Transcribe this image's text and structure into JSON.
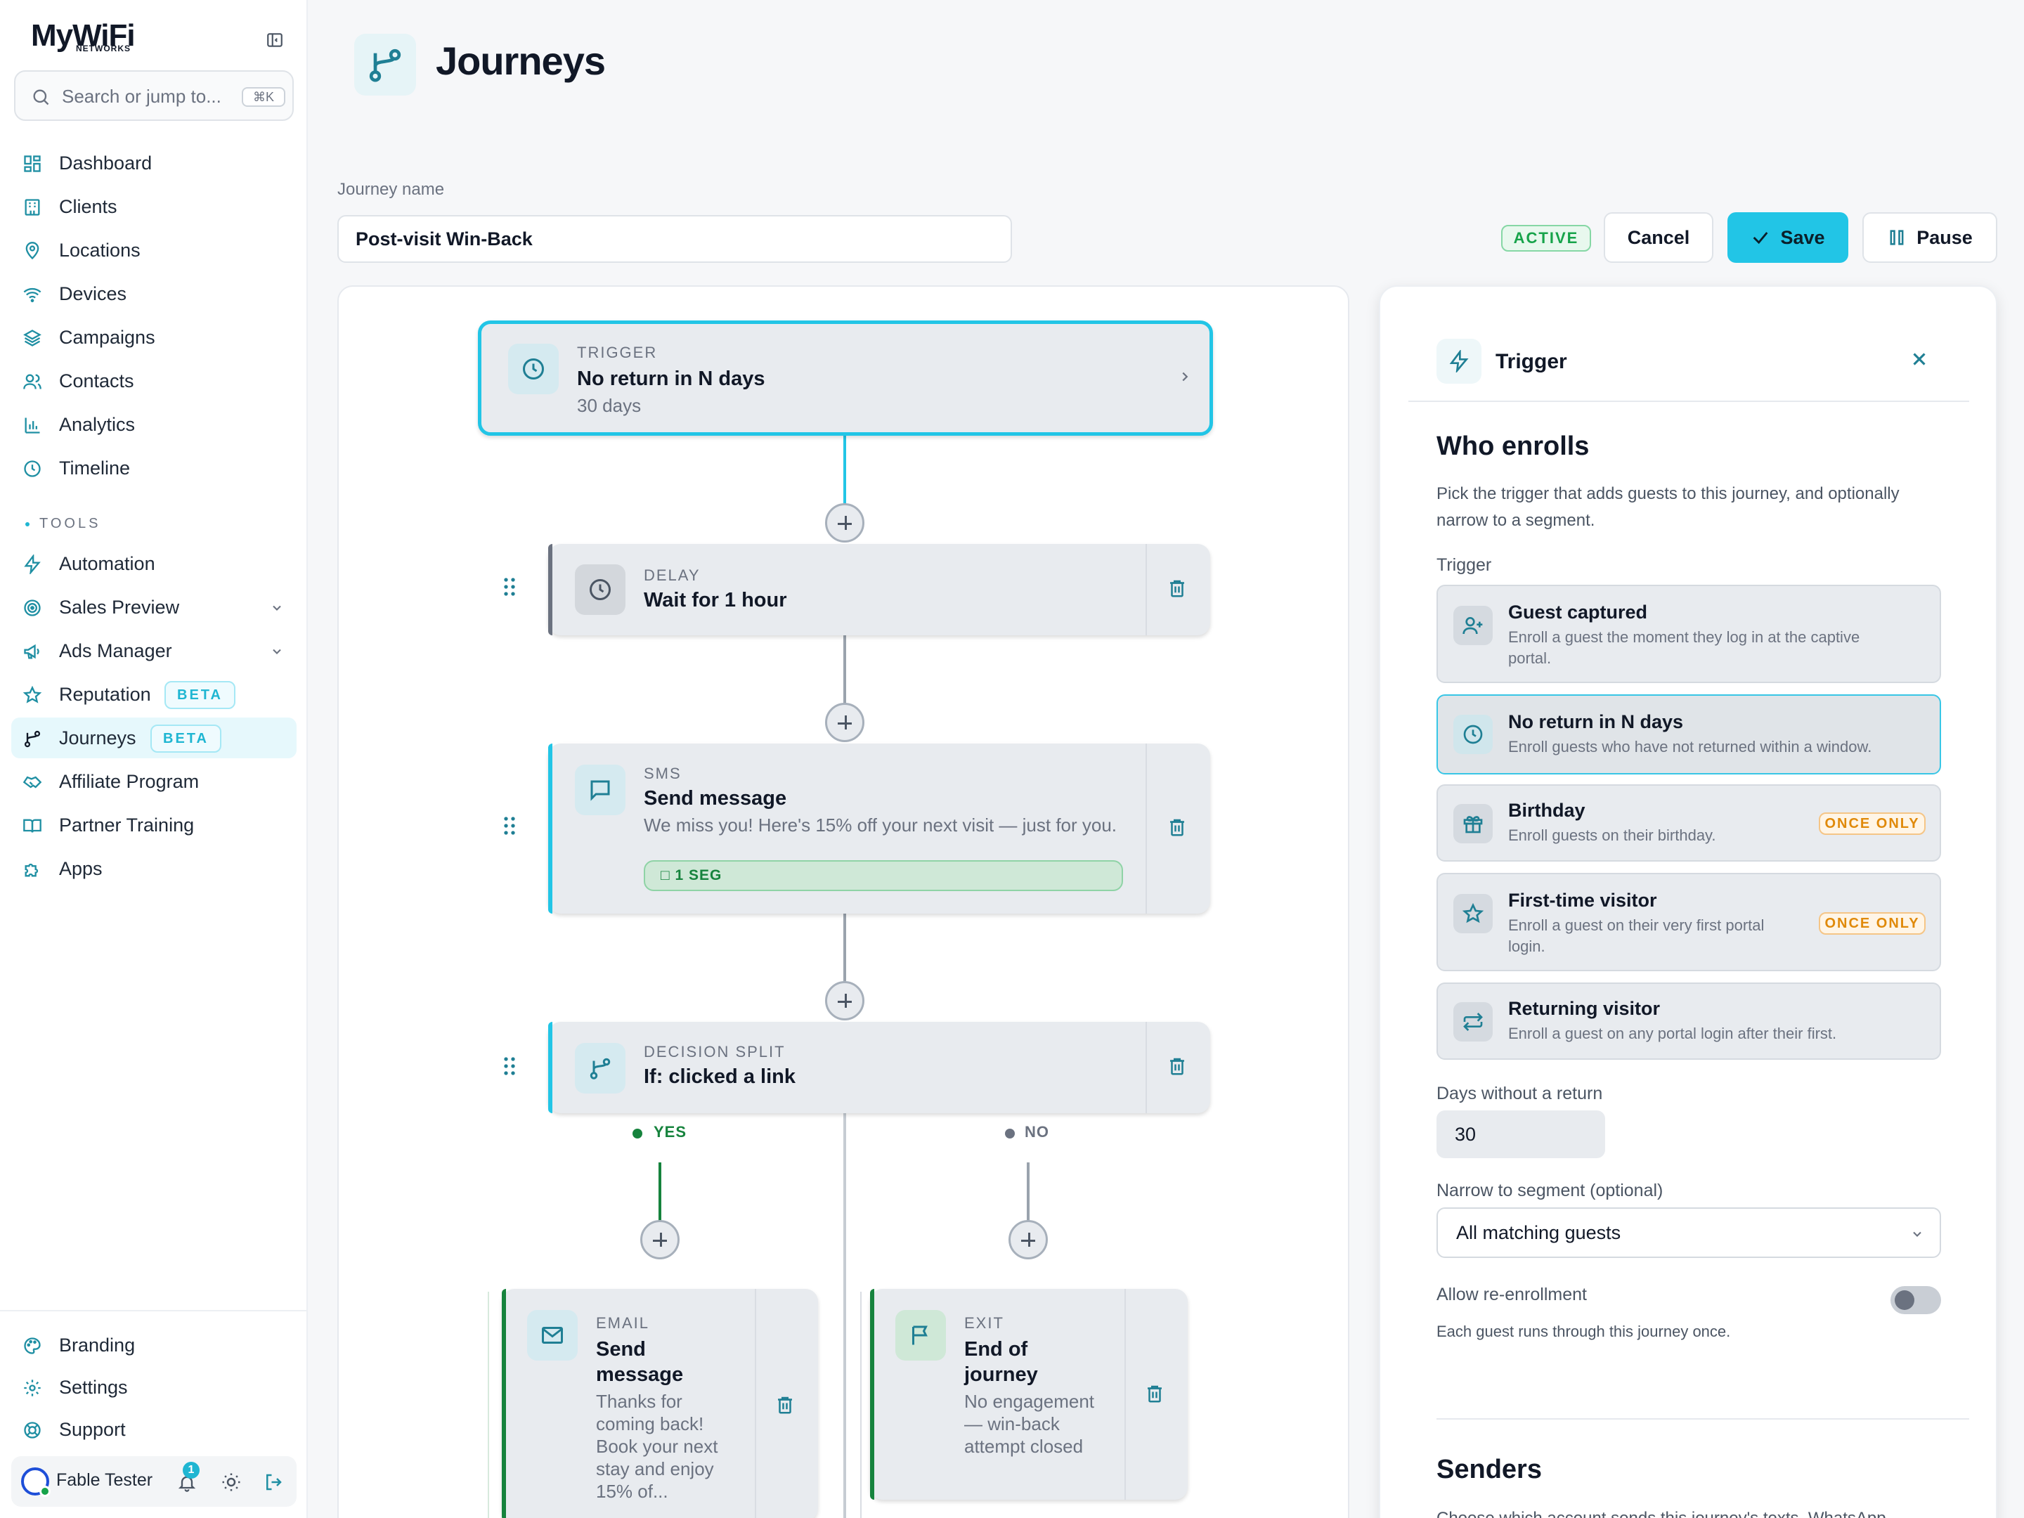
{
  "sidebar": {
    "logo": "MyWiFi",
    "logo_sub": "NETWORKS",
    "search_placeholder": "Search or jump to...",
    "search_shortcut": "⌘K",
    "items": [
      {
        "label": "Dashboard",
        "icon": "dashboard-icon"
      },
      {
        "label": "Clients",
        "icon": "building-icon"
      },
      {
        "label": "Locations",
        "icon": "map-pin-icon"
      },
      {
        "label": "Devices",
        "icon": "wifi-icon"
      },
      {
        "label": "Campaigns",
        "icon": "layers-icon"
      },
      {
        "label": "Contacts",
        "icon": "users-icon"
      },
      {
        "label": "Analytics",
        "icon": "bar-chart-icon"
      },
      {
        "label": "Timeline",
        "icon": "clock-icon"
      }
    ],
    "tools_label": "TOOLS",
    "tools": [
      {
        "label": "Automation",
        "icon": "bolt-icon"
      },
      {
        "label": "Sales Preview",
        "icon": "target-icon"
      },
      {
        "label": "Ads Manager",
        "icon": "megaphone-icon"
      },
      {
        "label": "Reputation",
        "icon": "star-icon",
        "badge": "BETA"
      },
      {
        "label": "Journeys",
        "icon": "branch-icon",
        "badge": "BETA"
      },
      {
        "label": "Affiliate Program",
        "icon": "handshake-icon"
      },
      {
        "label": "Partner Training",
        "icon": "book-icon"
      },
      {
        "label": "Apps",
        "icon": "puzzle-icon"
      }
    ],
    "bottom": [
      {
        "label": "Branding",
        "icon": "palette-icon"
      },
      {
        "label": "Settings",
        "icon": "gear-icon"
      },
      {
        "label": "Support",
        "icon": "lifebuoy-icon"
      }
    ],
    "user": {
      "name": "Fable Tester",
      "notifications": "1"
    }
  },
  "header": {
    "title": "Journeys",
    "journey_name_label": "Journey name",
    "journey_name": "Post-visit Win-Back",
    "status": "ACTIVE",
    "cancel": "Cancel",
    "save": "Save",
    "pause": "Pause"
  },
  "flow": {
    "trigger": {
      "kicker": "TRIGGER",
      "title": "No return in N days",
      "sub": "30 days"
    },
    "delay": {
      "kicker": "DELAY",
      "title": "Wait for 1 hour"
    },
    "sms": {
      "kicker": "SMS",
      "title": "Send message",
      "sub": "We miss you! Here's 15% off your next visit — just for you.",
      "seg": "□ 1 SEG"
    },
    "split": {
      "kicker": "DECISION SPLIT",
      "title": "If: clicked a link",
      "yes": "YES",
      "no": "NO"
    },
    "email": {
      "kicker": "EMAIL",
      "title": "Send message",
      "sub": "Thanks for coming back! Book your next stay and enjoy 15% of..."
    },
    "exit": {
      "kicker": "EXIT",
      "title": "End of journey",
      "sub": "No engagement — win-back attempt closed"
    }
  },
  "panel": {
    "title": "Trigger",
    "heading": "Who enrolls",
    "description": "Pick the trigger that adds guests to this journey, and optionally narrow to a segment.",
    "trigger_label": "Trigger",
    "options": [
      {
        "title": "Guest captured",
        "desc": "Enroll a guest the moment they log in at the captive portal.",
        "icon": "user-plus-icon"
      },
      {
        "title": "No return in N days",
        "desc": "Enroll guests who have not returned within a window.",
        "icon": "clock-icon",
        "selected": true
      },
      {
        "title": "Birthday",
        "desc": "Enroll guests on their birthday.",
        "icon": "gift-icon",
        "badge": "ONCE ONLY"
      },
      {
        "title": "First-time visitor",
        "desc": "Enroll a guest on their very first portal login.",
        "icon": "star-icon",
        "badge": "ONCE ONLY"
      },
      {
        "title": "Returning visitor",
        "desc": "Enroll a guest on any portal login after their first.",
        "icon": "repeat-icon"
      }
    ],
    "days_label": "Days without a return",
    "days_value": "30",
    "segment_label": "Narrow to segment (optional)",
    "segment_value": "All matching guests",
    "reenroll_label": "Allow re-enrollment",
    "reenroll_desc": "Each guest runs through this journey once.",
    "senders_heading": "Senders",
    "senders_desc": "Choose which account sends this journey's texts, WhatsApp..."
  },
  "colors": {
    "accent": "#22c5e6",
    "success": "#16a34a",
    "warning": "#e08a0b"
  }
}
